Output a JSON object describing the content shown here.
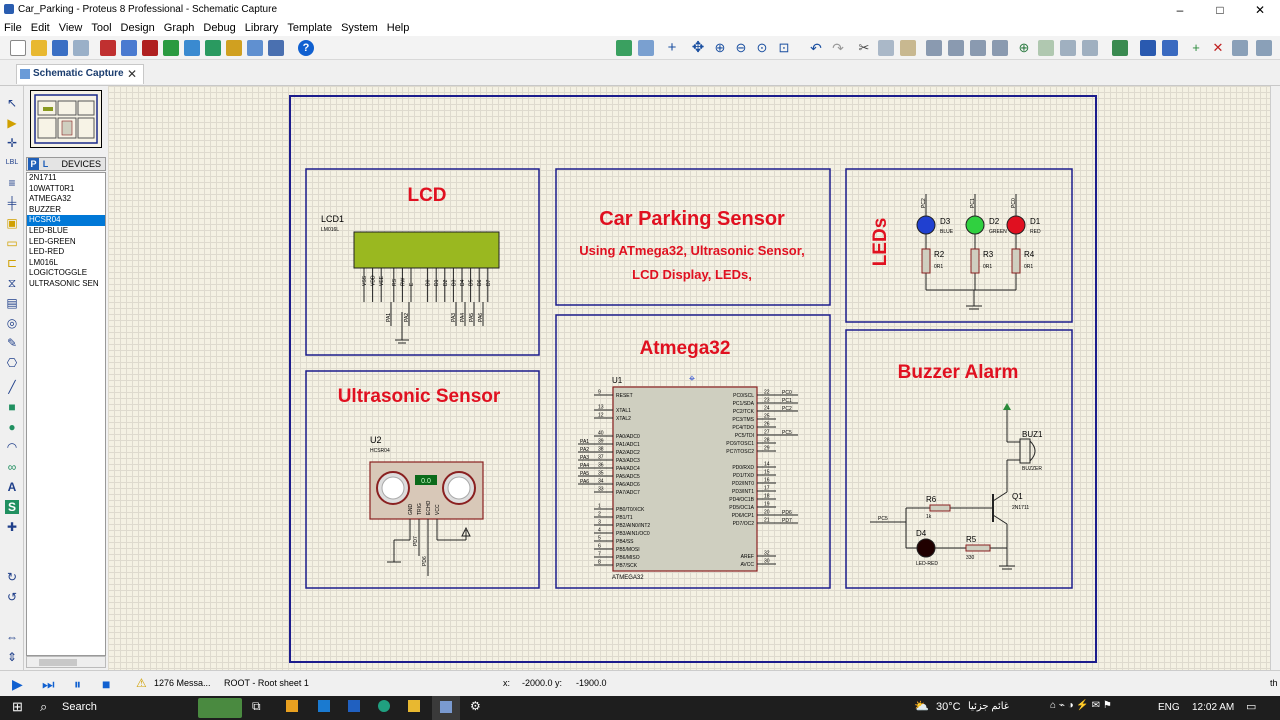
{
  "window": {
    "title": "Car_Parking - Proteus 8 Professional - Schematic Capture",
    "minimize": "–",
    "maximize": "□",
    "close": "✕"
  },
  "menu": [
    "File",
    "Edit",
    "View",
    "Tool",
    "Design",
    "Graph",
    "Debug",
    "Library",
    "Template",
    "System",
    "Help"
  ],
  "tab": {
    "label": "Schematic Capture",
    "close": "✕"
  },
  "devices": {
    "p_label": "P",
    "l_label": "L",
    "header": "DEVICES",
    "items": [
      "2N1711",
      "10WATT0R1",
      "ATMEGA32",
      "BUZZER",
      "HCSR04",
      "LED-BLUE",
      "LED-GREEN",
      "LED-RED",
      "LM016L",
      "LOGICTOGGLE",
      "ULTRASONIC SEN"
    ],
    "selected_index": 4
  },
  "schematic": {
    "lcd_title": "LCD",
    "lcd_ref": "LCD1",
    "lcd_part": "LM016L",
    "lcd_pins": [
      "VSS",
      "VDD",
      "VEE",
      "RS",
      "RW",
      "E",
      "D0",
      "D1",
      "D2",
      "D3",
      "D4",
      "D5",
      "D6",
      "D7"
    ],
    "lcd_nets": [
      "PA1",
      "PA2",
      "PA3",
      "PA4",
      "PA5",
      "PA6"
    ],
    "project_title": "Car Parking Sensor",
    "project_sub1": "Using ATmega32, Ultrasonic Sensor,",
    "project_sub2": "LCD Display, LEDs,",
    "leds_title": "LEDs",
    "led_labels": [
      {
        "ref": "D3",
        "part": "BLUE",
        "net": "PC2",
        "res": "R2",
        "val": "0R1",
        "color": "#2040d0"
      },
      {
        "ref": "D2",
        "part": "GREEN",
        "net": "PC1",
        "res": "R3",
        "val": "0R1",
        "color": "#30d040"
      },
      {
        "ref": "D1",
        "part": "RED",
        "net": "PC0",
        "res": "R4",
        "val": "0R1",
        "color": "#e01020"
      }
    ],
    "us_title": "Ultrasonic Sensor",
    "us_ref": "U2",
    "us_part": "HCSR04",
    "us_display": "0.0",
    "us_pins": [
      "GND",
      "TRIG",
      "ECHO",
      "VCC"
    ],
    "us_nets": [
      "PD7",
      "PD6"
    ],
    "mcu_title": "Atmega32",
    "mcu_ref": "U1",
    "mcu_part": "ATMEGA32",
    "mcu_left_pins": [
      {
        "num": "9",
        "name": "RESET"
      },
      {
        "num": "13",
        "name": "XTAL1"
      },
      {
        "num": "12",
        "name": "XTAL2"
      },
      {
        "num": "40",
        "name": "PA0/ADC0"
      },
      {
        "num": "39",
        "name": "PA1/ADC1"
      },
      {
        "num": "38",
        "name": "PA2/ADC2"
      },
      {
        "num": "37",
        "name": "PA3/ADC3"
      },
      {
        "num": "36",
        "name": "PA4/ADC4"
      },
      {
        "num": "35",
        "name": "PA5/ADC5"
      },
      {
        "num": "34",
        "name": "PA6/ADC6"
      },
      {
        "num": "33",
        "name": "PA7/ADC7"
      },
      {
        "num": "1",
        "name": "PB0/T0/XCK"
      },
      {
        "num": "2",
        "name": "PB1/T1"
      },
      {
        "num": "3",
        "name": "PB2/AIN0/INT2"
      },
      {
        "num": "4",
        "name": "PB3/AIN1/OC0"
      },
      {
        "num": "5",
        "name": "PB4/SS"
      },
      {
        "num": "6",
        "name": "PB5/MOSI"
      },
      {
        "num": "7",
        "name": "PB6/MISO"
      },
      {
        "num": "8",
        "name": "PB7/SCK"
      }
    ],
    "mcu_right_pins": [
      {
        "num": "22",
        "name": "PC0/SCL"
      },
      {
        "num": "23",
        "name": "PC1/SDA"
      },
      {
        "num": "24",
        "name": "PC2/TCK"
      },
      {
        "num": "25",
        "name": "PC3/TMS"
      },
      {
        "num": "26",
        "name": "PC4/TDO"
      },
      {
        "num": "27",
        "name": "PC5/TDI"
      },
      {
        "num": "28",
        "name": "PC6/TOSC1"
      },
      {
        "num": "29",
        "name": "PC7/TOSC2"
      },
      {
        "num": "14",
        "name": "PD0/RXD"
      },
      {
        "num": "15",
        "name": "PD1/TXD"
      },
      {
        "num": "16",
        "name": "PD2/INT0"
      },
      {
        "num": "17",
        "name": "PD3/INT1"
      },
      {
        "num": "18",
        "name": "PD4/OC1B"
      },
      {
        "num": "19",
        "name": "PD5/OC1A"
      },
      {
        "num": "20",
        "name": "PD6/ICP1"
      },
      {
        "num": "21",
        "name": "PD7/OC2"
      },
      {
        "num": "32",
        "name": "AREF"
      },
      {
        "num": "30",
        "name": "AVCC"
      }
    ],
    "mcu_left_nets": [
      "PA1",
      "PA2",
      "PA3",
      "PA4",
      "PA5",
      "PA6"
    ],
    "mcu_right_nets": [
      "PC0",
      "PC1",
      "PC2",
      "PC5",
      "PD6",
      "PD7"
    ],
    "buzzer_title": "Buzzer Alarm",
    "buz_ref": "BUZ1",
    "buz_part": "BUZZER",
    "q_ref": "Q1",
    "q_part": "2N1711",
    "r6": "R6",
    "r6_val": "1k",
    "r5": "R5",
    "r5_val": "330",
    "d4": "D4",
    "d4_part": "LED-RED",
    "buz_net": "PC5"
  },
  "status": {
    "messages": "1276 Messa...",
    "sheet": "ROOT - Root sheet 1",
    "x_label": "x:",
    "x_val": "-2000.0",
    "y_label": "y:",
    "y_val": "-1900.0",
    "right": "th"
  },
  "taskbar": {
    "search": "Search",
    "weather": "30°C",
    "weather_desc": "غائم جزئيا",
    "lang": "ENG",
    "time": "12:02 AM"
  }
}
